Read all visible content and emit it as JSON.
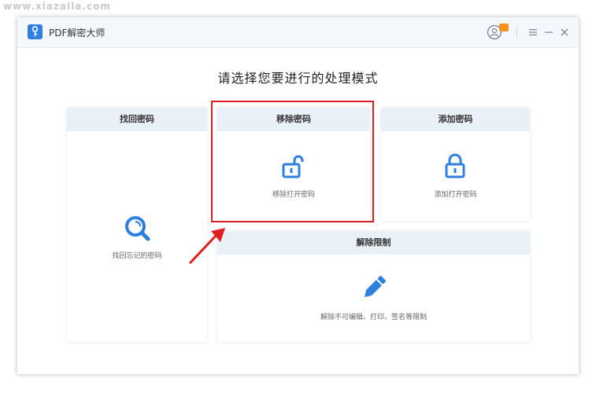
{
  "watermark": "www.xiazaila.com",
  "window": {
    "title": "PDF解密大师",
    "accent": "#2f7fe0"
  },
  "titlebar_icons": [
    "key-icon",
    "user-icon",
    "vip-badge-icon",
    "menu-icon",
    "minimize-icon",
    "close-icon"
  ],
  "heading": "请选择您要进行的处理模式",
  "cards": {
    "find": {
      "title": "找回密码",
      "desc": "找回忘记的密码",
      "icon": "magnifier-icon"
    },
    "remove": {
      "title": "移除密码",
      "desc": "移除打开密码",
      "icon": "unlocked-padlock-icon"
    },
    "add": {
      "title": "添加密码",
      "desc": "添加打开密码",
      "icon": "locked-padlock-icon"
    },
    "unlock": {
      "title": "解除限制",
      "desc": "解除不可编辑、打印、签名等限制",
      "icon": "pencil-icon"
    }
  },
  "annotation": {
    "color": "#e02020",
    "highlighted_card": "移除密码"
  }
}
